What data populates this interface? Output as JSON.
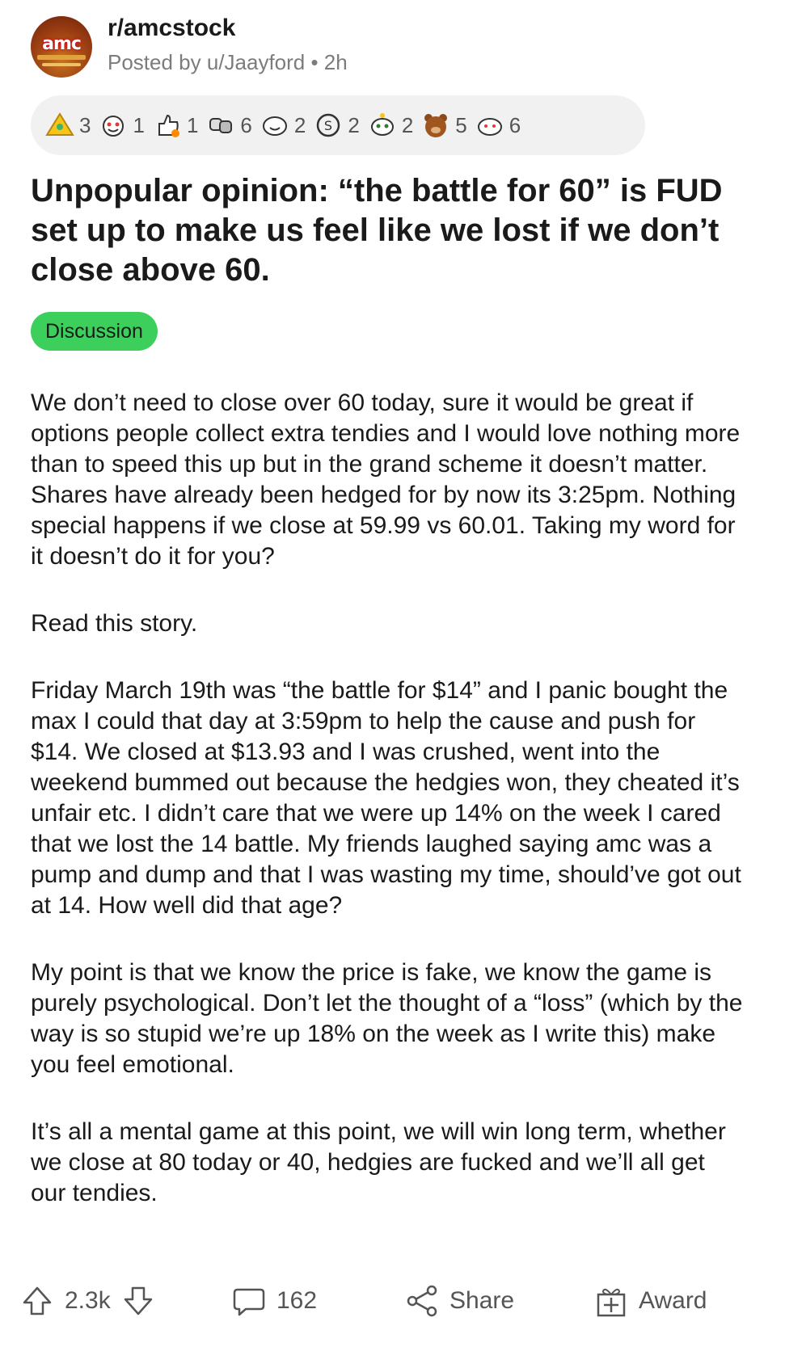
{
  "post": {
    "subreddit": "r/amcstock",
    "meta": "Posted by u/Jaayford • 2h",
    "avatar_text": "amc",
    "awards": [
      {
        "icon": "ternion-award-icon",
        "count": "3"
      },
      {
        "icon": "wholesome-award-icon",
        "count": "1"
      },
      {
        "icon": "rocket-like-award-icon",
        "count": "1"
      },
      {
        "icon": "fist-bump-award-icon",
        "count": "6"
      },
      {
        "icon": "smile-award-icon",
        "count": "2"
      },
      {
        "icon": "silver-coin-award-icon",
        "count": "2"
      },
      {
        "icon": "snoo-award-icon",
        "count": "2"
      },
      {
        "icon": "bear-award-icon",
        "count": "5"
      },
      {
        "icon": "helpful-award-icon",
        "count": "6"
      }
    ],
    "title": "Unpopular opinion: “the battle for 60” is FUD set up to make us feel like we lost if we don’t close above 60.",
    "flair": "Discussion",
    "paragraphs": [
      "We don’t need to close over 60 today, sure it would be great if options people collect extra tendies and I would love nothing more than to speed this up but in the grand scheme it doesn’t matter. Shares have already been hedged for by now its 3:25pm. Nothing special happens if we close at 59.99 vs 60.01. Taking my word for it doesn’t do it for you?",
      "Read this story.",
      "Friday March 19th was “the battle for $14” and I panic bought the max I could that day at 3:59pm to help the cause and push for $14. We closed at $13.93 and I was crushed, went into the weekend bummed out because the hedgies won, they cheated it’s unfair etc. I didn’t care that we were up 14% on the week I cared that we lost the 14 battle. My friends laughed saying amc was a pump and dump and that I was wasting my time, should’ve got out at 14. How well did that age?",
      "My point is that we know the price is fake, we know the game is purely psychological. Don’t let the thought of a “loss” (which by the way is so stupid we’re up 18% on the week as I write this) make you feel emotional.",
      "It’s all a mental game at this point, we will win long term, whether we close at 80 today or 40, hedgies are fucked and we’ll all get our tendies."
    ]
  },
  "actions": {
    "votes": "2.3k",
    "comments": "162",
    "share": "Share",
    "award": "Award"
  },
  "colors": {
    "flair_bg": "#3dcf5c",
    "award_bar_bg": "#f1f1f2",
    "meta_text": "#7c7c7c"
  }
}
